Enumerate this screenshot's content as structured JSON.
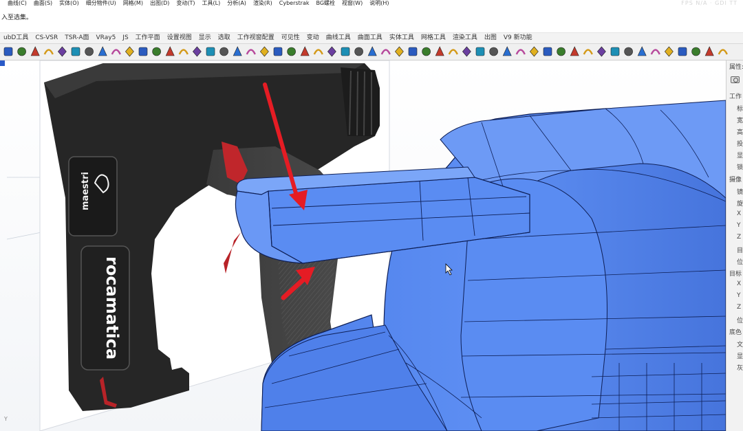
{
  "menubar": {
    "items": [
      "曲线(C)",
      "曲面(S)",
      "实体(O)",
      "细分物件(U)",
      "网格(M)",
      "出图(D)",
      "变动(T)",
      "工具(L)",
      "分析(A)",
      "渲染(R)",
      "Cyberstrak",
      "BG螺栓",
      "视窗(W)",
      "说明(H)"
    ],
    "fps": "FPS N/A · GDI TT"
  },
  "command": {
    "prompt": "入至选集。"
  },
  "tabs": [
    "ubD工具",
    "CS-VSR",
    "TSR-A面",
    "VRay5",
    "JS",
    "工作平面",
    "设置视图",
    "显示",
    "选取",
    "工作视窗配置",
    "可见性",
    "变动",
    "曲线工具",
    "曲面工具",
    "实体工具",
    "网格工具",
    "渲染工具",
    "出图",
    "V9 新功能"
  ],
  "viewport": {
    "axis_label": "Y",
    "reference_image": {
      "brand_logo": "maestri",
      "product_name": "rocamatica"
    }
  },
  "properties_panel": {
    "title": "属性:",
    "rows": [
      "工作",
      "标",
      "宽",
      "高",
      "投",
      "显",
      "锁",
      "摄像",
      "镜",
      "旋",
      "X",
      "Y",
      "Z",
      "目",
      "位",
      "目标",
      "X",
      "Y",
      "Z",
      "位",
      "底色",
      "文",
      "显",
      "灰"
    ]
  },
  "colors": {
    "model_blue": "#5a8cf2",
    "model_edge": "#0d1e55",
    "arrow_red": "#e51c24",
    "tool_body": "#2b2b2b"
  }
}
